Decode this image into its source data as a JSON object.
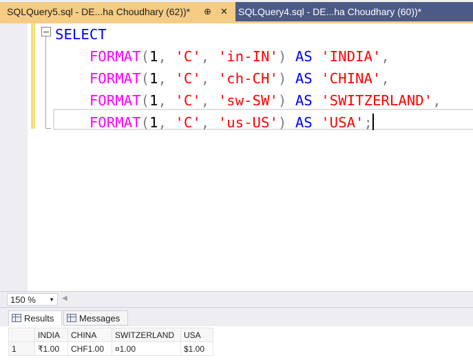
{
  "tabs": [
    {
      "title": "SQLQuery5.sql - DE...ha Choudhary (62))*",
      "active": true
    },
    {
      "title": "SQLQuery4.sql - DE...ha Choudhary (60))*",
      "active": false
    }
  ],
  "tab_icons": {
    "pin": "pin-icon",
    "close": "close-icon"
  },
  "editor": {
    "lines": [
      [
        {
          "t": "SELECT",
          "c": "kw"
        }
      ],
      [
        {
          "t": "    ",
          "c": "nu"
        },
        {
          "t": "FORMAT",
          "c": "fn"
        },
        {
          "t": "(",
          "c": "pu"
        },
        {
          "t": "1",
          "c": "nu"
        },
        {
          "t": ", ",
          "c": "pu"
        },
        {
          "t": "'C'",
          "c": "st"
        },
        {
          "t": ", ",
          "c": "pu"
        },
        {
          "t": "'in-IN'",
          "c": "st"
        },
        {
          "t": ") ",
          "c": "pu"
        },
        {
          "t": "AS",
          "c": "kw"
        },
        {
          "t": " ",
          "c": "nu"
        },
        {
          "t": "'INDIA'",
          "c": "st"
        },
        {
          "t": ",",
          "c": "pu"
        }
      ],
      [
        {
          "t": "    ",
          "c": "nu"
        },
        {
          "t": "FORMAT",
          "c": "fn"
        },
        {
          "t": "(",
          "c": "pu"
        },
        {
          "t": "1",
          "c": "nu"
        },
        {
          "t": ", ",
          "c": "pu"
        },
        {
          "t": "'C'",
          "c": "st"
        },
        {
          "t": ", ",
          "c": "pu"
        },
        {
          "t": "'ch-CH'",
          "c": "st"
        },
        {
          "t": ") ",
          "c": "pu"
        },
        {
          "t": "AS",
          "c": "kw"
        },
        {
          "t": " ",
          "c": "nu"
        },
        {
          "t": "'CHINA'",
          "c": "st"
        },
        {
          "t": ",",
          "c": "pu"
        }
      ],
      [
        {
          "t": "    ",
          "c": "nu"
        },
        {
          "t": "FORMAT",
          "c": "fn"
        },
        {
          "t": "(",
          "c": "pu"
        },
        {
          "t": "1",
          "c": "nu"
        },
        {
          "t": ", ",
          "c": "pu"
        },
        {
          "t": "'C'",
          "c": "st"
        },
        {
          "t": ", ",
          "c": "pu"
        },
        {
          "t": "'sw-SW'",
          "c": "st"
        },
        {
          "t": ") ",
          "c": "pu"
        },
        {
          "t": "AS",
          "c": "kw"
        },
        {
          "t": " ",
          "c": "nu"
        },
        {
          "t": "'SWITZERLAND'",
          "c": "st"
        },
        {
          "t": ",",
          "c": "pu"
        }
      ],
      [
        {
          "t": "    ",
          "c": "nu"
        },
        {
          "t": "FORMAT",
          "c": "fn"
        },
        {
          "t": "(",
          "c": "pu"
        },
        {
          "t": "1",
          "c": "nu"
        },
        {
          "t": ", ",
          "c": "pu"
        },
        {
          "t": "'C'",
          "c": "st"
        },
        {
          "t": ", ",
          "c": "pu"
        },
        {
          "t": "'us-US'",
          "c": "st"
        },
        {
          "t": ") ",
          "c": "pu"
        },
        {
          "t": "AS",
          "c": "kw"
        },
        {
          "t": " ",
          "c": "nu"
        },
        {
          "t": "'USA'",
          "c": "st"
        },
        {
          "t": ";",
          "c": "pu"
        }
      ]
    ],
    "colors": {
      "keyword": "#0000ff",
      "function": "#ff00ff",
      "string": "#ff0000",
      "punctuation": "#808080"
    }
  },
  "zoom": {
    "value": "150 %"
  },
  "results_tabs": [
    {
      "label": "Results",
      "icon": "grid-icon",
      "active": true
    },
    {
      "label": "Messages",
      "icon": "messages-icon",
      "active": false
    }
  ],
  "grid": {
    "columns": [
      "INDIA",
      "CHINA",
      "SWITZERLAND",
      "USA"
    ],
    "rows": [
      {
        "num": "1",
        "cells": [
          "₹1.00",
          "CHF1.00",
          "¤1.00",
          "$1.00"
        ]
      }
    ]
  },
  "colors": {
    "active_tab": "#f5cc84",
    "inactive_tab": "#4b5a86",
    "change_bar": "#f5e07a"
  }
}
